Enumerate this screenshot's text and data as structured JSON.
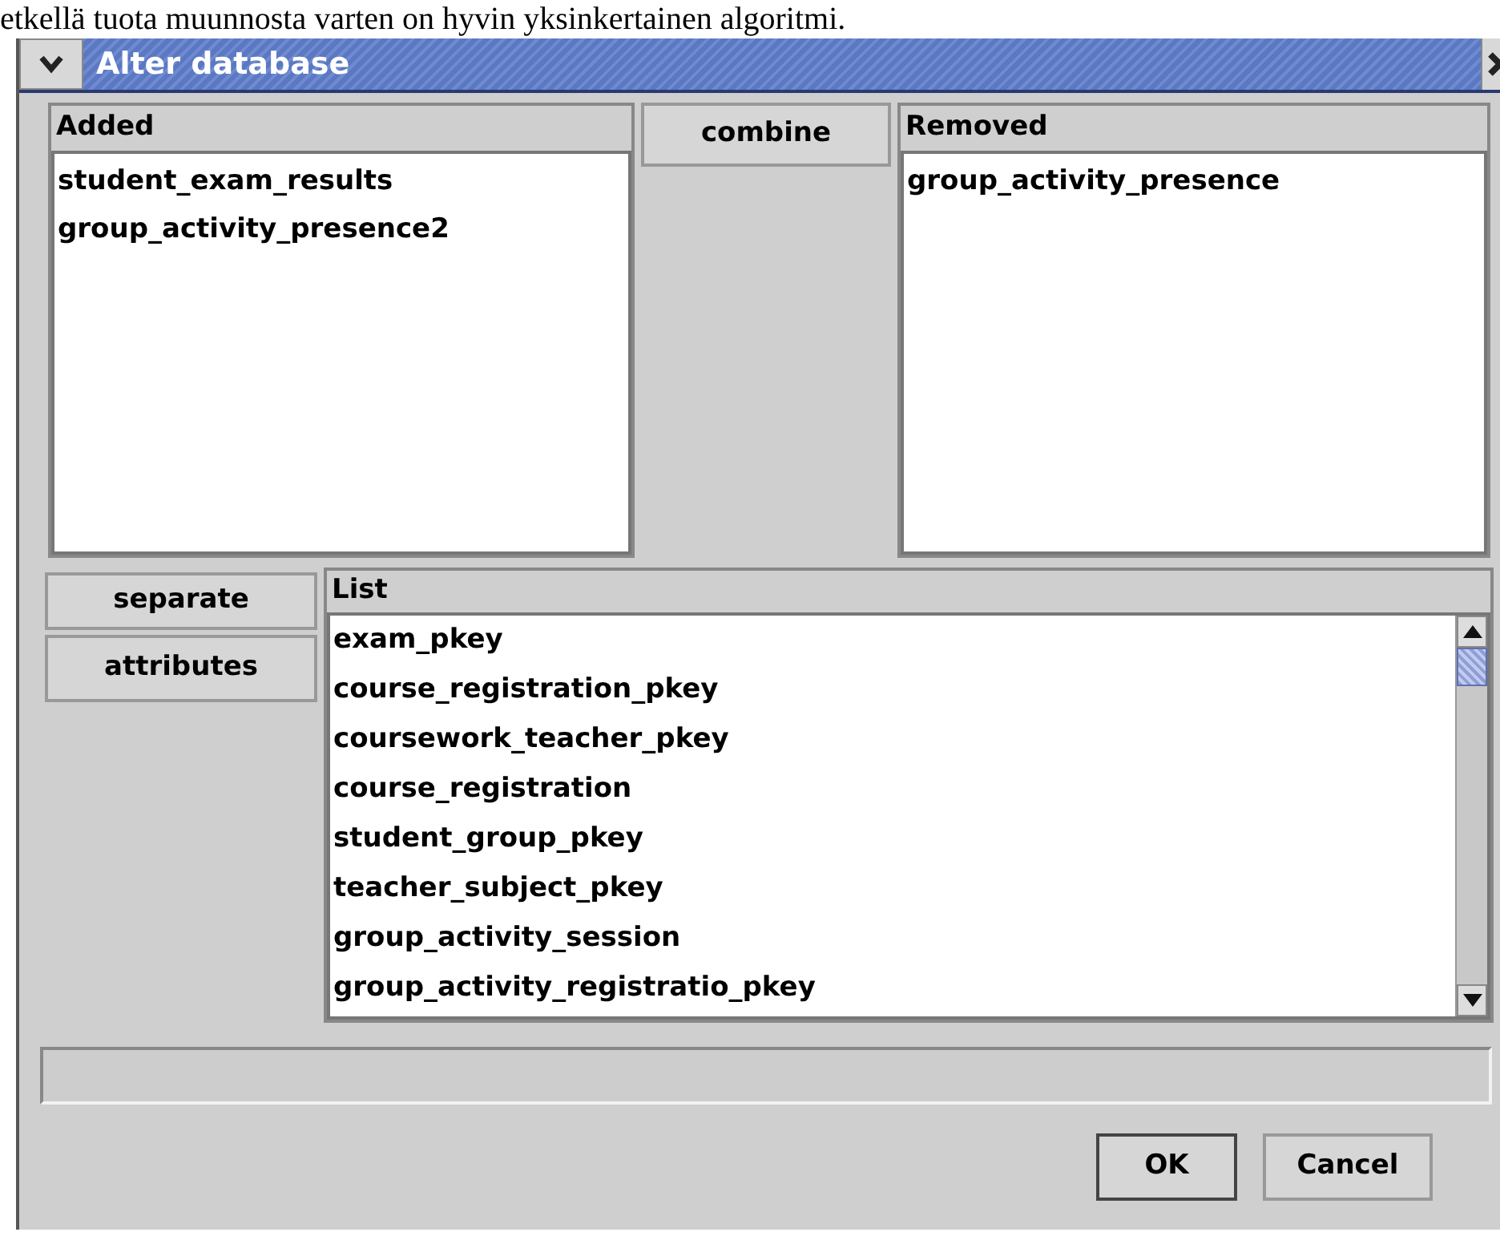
{
  "caption_fragment": "etkellä tuota muunnosta varten on hyvin yksinkertainen algoritmi.",
  "window": {
    "title": "Alter database"
  },
  "added": {
    "header": "Added",
    "items": [
      "student_exam_results",
      "group_activity_presence2"
    ]
  },
  "combine_button": "combine",
  "removed": {
    "header": "Removed",
    "items": [
      "group_activity_presence"
    ]
  },
  "side_buttons": [
    "separate",
    "attributes"
  ],
  "list": {
    "header": "List",
    "items": [
      "exam_pkey",
      "course_registration_pkey",
      "coursework_teacher_pkey",
      "course_registration",
      "student_group_pkey",
      "teacher_subject_pkey",
      "group_activity_session",
      "group_activity_registratio_pkey"
    ]
  },
  "buttons": [
    "OK",
    "Cancel"
  ]
}
